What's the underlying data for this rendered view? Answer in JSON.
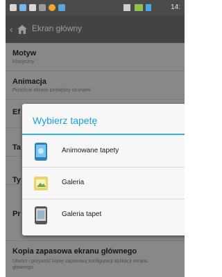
{
  "statusbar": {
    "time": "14:"
  },
  "header": {
    "title": "Ekran główny"
  },
  "settings": [
    {
      "title": "Motyw",
      "subtitle": "Klasyczny"
    },
    {
      "title": "Animacja",
      "subtitle": "Przejście ekranu pomiędzy stronami"
    },
    {
      "title": "Ef",
      "subtitle": ""
    },
    {
      "title": "Ta",
      "subtitle": ""
    },
    {
      "title": "Ty",
      "subtitle": ""
    },
    {
      "title": "Pr",
      "subtitle": ""
    },
    {
      "title": "Kopia zapasowa ekranu głównego",
      "subtitle": "Utwórz i przywróć kopię zapasową konfiguracji aplikacji ekranu głównego"
    }
  ],
  "dialog": {
    "title": "Wybierz tapetę",
    "options": [
      {
        "label": "Animowane tapety",
        "icon": "live-wallpaper-icon"
      },
      {
        "label": "Galeria",
        "icon": "gallery-icon"
      },
      {
        "label": "Galeria tapet",
        "icon": "wallpaper-gallery-icon"
      }
    ]
  },
  "colors": {
    "accent": "#2fb0e3",
    "title": "#1aa0d8"
  }
}
